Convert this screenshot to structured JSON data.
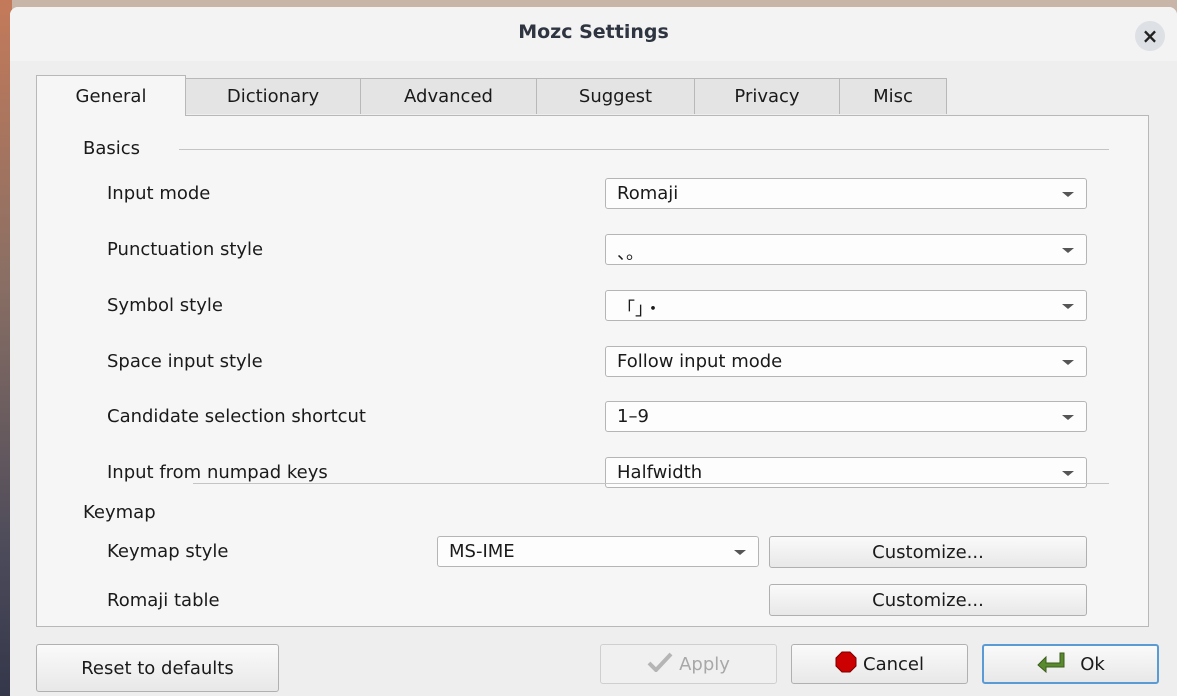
{
  "window": {
    "title": "Mozc Settings",
    "close_label": "×"
  },
  "tabs": [
    "General",
    "Dictionary",
    "Advanced",
    "Suggest",
    "Privacy",
    "Misc"
  ],
  "basics": {
    "title": "Basics",
    "rows": [
      {
        "label": "Input mode",
        "value": "Romaji"
      },
      {
        "label": "Punctuation style",
        "value": "、。"
      },
      {
        "label": "Symbol style",
        "value": "「」・"
      },
      {
        "label": "Space input style",
        "value": "Follow input mode"
      },
      {
        "label": "Candidate selection shortcut",
        "value": "1–9"
      },
      {
        "label": "Input from numpad keys",
        "value": "Halfwidth"
      }
    ]
  },
  "keymap": {
    "title": "Keymap",
    "style_label": "Keymap style",
    "style_value": "MS-IME",
    "customize_label": "Customize...",
    "romaji_label": "Romaji table",
    "romaji_customize_label": "Customize..."
  },
  "footer": {
    "reset": "Reset to defaults",
    "apply": "Apply",
    "cancel": "Cancel",
    "ok": "Ok"
  },
  "colors": {
    "focus_border": "#5b9bd5",
    "cancel_icon": "#cc0000",
    "ok_icon": "#4e7a27"
  }
}
